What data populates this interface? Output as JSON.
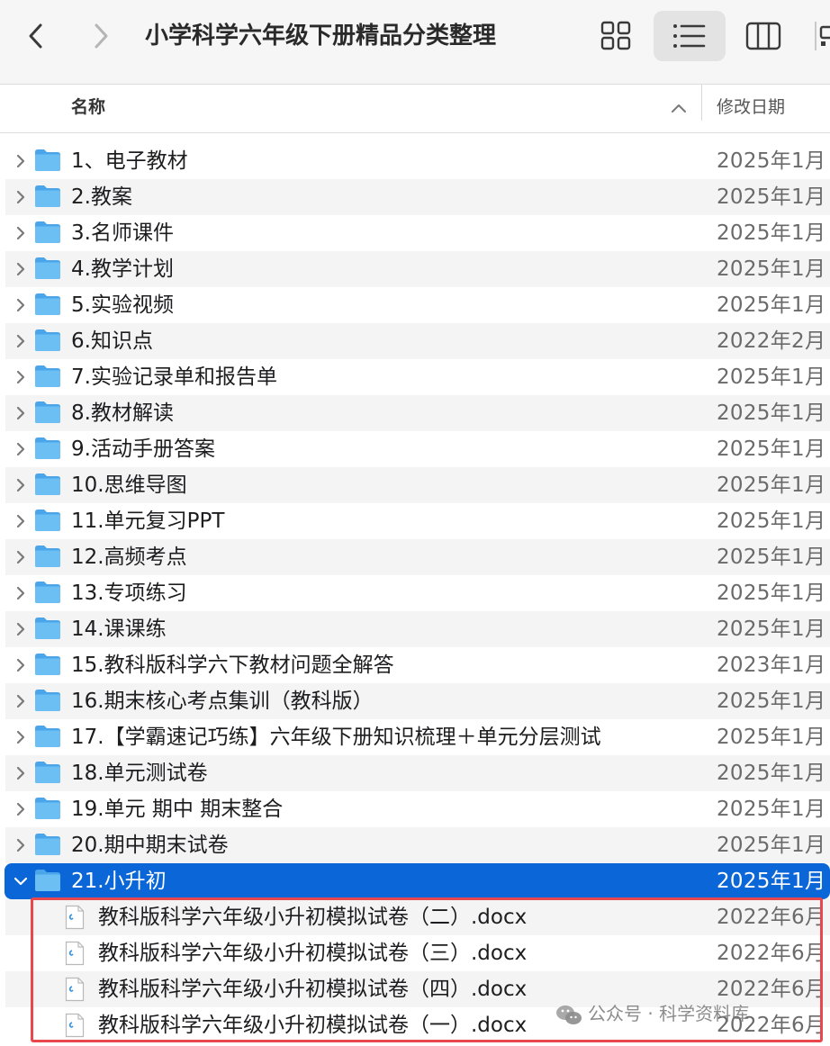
{
  "window": {
    "title": "小学科学六年级下册精品分类整理"
  },
  "toolbar": {
    "back_icon": "chevron-left-icon",
    "forward_icon": "chevron-right-icon",
    "view_modes": [
      "grid-view-icon",
      "list-view-icon",
      "column-view-icon",
      "gallery-view-icon"
    ],
    "active_view": "list"
  },
  "header": {
    "name_label": "名称",
    "date_label": "修改日期",
    "sort_icon": "chevron-up-icon"
  },
  "folders": [
    {
      "name": "1、电子教材",
      "date": "2025年1月"
    },
    {
      "name": "2.教案",
      "date": "2025年1月"
    },
    {
      "name": "3.名师课件",
      "date": "2025年1月"
    },
    {
      "name": "4.教学计划",
      "date": "2025年1月"
    },
    {
      "name": "5.实验视频",
      "date": "2025年1月"
    },
    {
      "name": "6.知识点",
      "date": "2022年2月"
    },
    {
      "name": "7.实验记录单和报告单",
      "date": "2025年1月"
    },
    {
      "name": "8.教材解读",
      "date": "2025年1月"
    },
    {
      "name": "9.活动手册答案",
      "date": "2025年1月"
    },
    {
      "name": "10.思维导图",
      "date": "2025年1月"
    },
    {
      "name": "11.单元复习PPT",
      "date": "2025年1月"
    },
    {
      "name": "12.高频考点",
      "date": "2025年1月"
    },
    {
      "name": "13.专项练习",
      "date": "2025年1月"
    },
    {
      "name": "14.课课练",
      "date": "2025年1月"
    },
    {
      "name": "15.教科版科学六下教材问题全解答",
      "date": "2023年1月"
    },
    {
      "name": "16.期末核心考点集训（教科版）",
      "date": "2025年1月"
    },
    {
      "name": "17.【学霸速记巧练】六年级下册知识梳理＋单元分层测试",
      "date": "2025年1月"
    },
    {
      "name": "18.单元测试卷",
      "date": "2025年1月"
    },
    {
      "name": "19.单元 期中 期末整合",
      "date": "2025年1月"
    },
    {
      "name": "20.期中期末试卷",
      "date": "2025年1月"
    },
    {
      "name": "21.小升初",
      "date": "2025年1月",
      "expanded": true,
      "selected": true
    }
  ],
  "files": [
    {
      "name": "教科版科学六年级小升初模拟试卷（二）.docx",
      "date": "2022年6月"
    },
    {
      "name": "教科版科学六年级小升初模拟试卷（三）.docx",
      "date": "2022年6月"
    },
    {
      "name": "教科版科学六年级小升初模拟试卷（四）.docx",
      "date": "2022年6月"
    },
    {
      "name": "教科版科学六年级小升初模拟试卷（一）.docx",
      "date": "2022年6月"
    }
  ],
  "watermark": {
    "text": "公众号 · 科学资料库",
    "icon": "wechat-icon"
  },
  "colors": {
    "selection": "#0b66d8",
    "folder": "#5fb4ee",
    "highlight_border": "#e8474e"
  }
}
